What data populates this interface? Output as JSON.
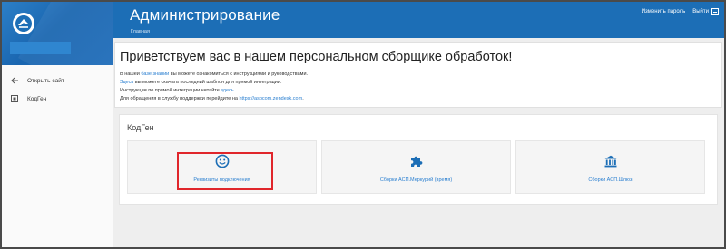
{
  "header": {
    "title": "Администрирование",
    "breadcrumb": "Главная",
    "change_password": "Изменить пароль",
    "logout": "Выйти"
  },
  "sidebar": {
    "items": [
      {
        "label": "Открыть сайт",
        "icon": "arrow-left-icon"
      },
      {
        "label": "КодГен",
        "icon": "codegen-icon"
      }
    ]
  },
  "welcome": {
    "heading": "Приветствуем вас в нашем персональном сборщике обработок!",
    "line1_pre": "В нашей ",
    "line1_link": "базе знаний",
    "line1_post": " вы можете ознакомиться с инструкциями и руководствами.",
    "line2_link": "Здесь",
    "line2_post": " вы можете скачать последний шаблон для прямой интеграции.",
    "line3_pre": "Инструкции по прямой интеграции читайте ",
    "line3_link": "здесь",
    "line3_post": ".",
    "line4_pre": "Для обращения в службу поддержки перейдите на ",
    "line4_link": "https://aspcom.zendesk.com",
    "line4_post": "."
  },
  "codegen": {
    "title": "КодГен",
    "tiles": [
      {
        "label": "Реквизиты подключения",
        "icon": "smiley-icon"
      },
      {
        "label": "Сборки АСП.Меркурий (время)",
        "icon": "puzzle-icon"
      },
      {
        "label": "Сборки АСП.Шлюз",
        "icon": "bank-icon"
      }
    ]
  },
  "colors": {
    "header_blue": "#1c6eb6",
    "link_blue": "#2a7fd0",
    "highlight_red": "#e0262b"
  }
}
